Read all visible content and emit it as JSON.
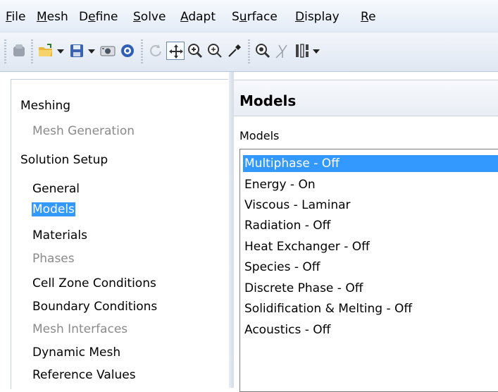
{
  "menubar": {
    "items": [
      {
        "underline": "F",
        "rest": "ile"
      },
      {
        "underline": "M",
        "rest": "esh"
      },
      {
        "pre": "D",
        "underline": "e",
        "rest": "fine"
      },
      {
        "underline": "S",
        "rest": "olve"
      },
      {
        "underline": "A",
        "rest": "dapt"
      },
      {
        "pre": "S",
        "underline": "u",
        "rest": "rface"
      },
      {
        "underline": "D",
        "rest": "isplay"
      },
      {
        "underline": "R",
        "rest": "e"
      }
    ]
  },
  "toolbar": {
    "icons": [
      "stop-icon",
      "open-folder-icon",
      "save-icon",
      "snapshot-icon",
      "help-icon",
      "rotate-icon",
      "pan-icon",
      "zoom-in-icon",
      "zoom-icon",
      "probe-icon",
      "zoom-to-fit-icon",
      "axes-icon",
      "columns-icon"
    ]
  },
  "navigation": {
    "sections": [
      {
        "label": "Meshing",
        "items": [
          {
            "label": "Mesh Generation",
            "state": "disabled"
          }
        ]
      },
      {
        "label": "Solution Setup",
        "items": [
          {
            "label": "General",
            "state": "normal"
          },
          {
            "label": "Models",
            "state": "selected"
          },
          {
            "label": "Materials",
            "state": "normal"
          },
          {
            "label": "Phases",
            "state": "disabled"
          },
          {
            "label": "Cell Zone Conditions",
            "state": "normal"
          },
          {
            "label": "Boundary Conditions",
            "state": "normal"
          },
          {
            "label": "Mesh Interfaces",
            "state": "disabled"
          },
          {
            "label": "Dynamic Mesh",
            "state": "normal"
          },
          {
            "label": "Reference Values",
            "state": "normal"
          }
        ]
      }
    ]
  },
  "panel": {
    "title": "Models",
    "list_label": "Models",
    "models": [
      "Multiphase - Off",
      "Energy - On",
      "Viscous - Laminar",
      "Radiation - Off",
      "Heat Exchanger - Off",
      "Species - Off",
      "Discrete Phase - Off",
      "Solidification & Melting - Off",
      "Acoustics - Off"
    ],
    "selected_model": "Multiphase - Off"
  },
  "colors": {
    "selection": "#3399ff",
    "disabled_text": "#8a8a8a"
  }
}
